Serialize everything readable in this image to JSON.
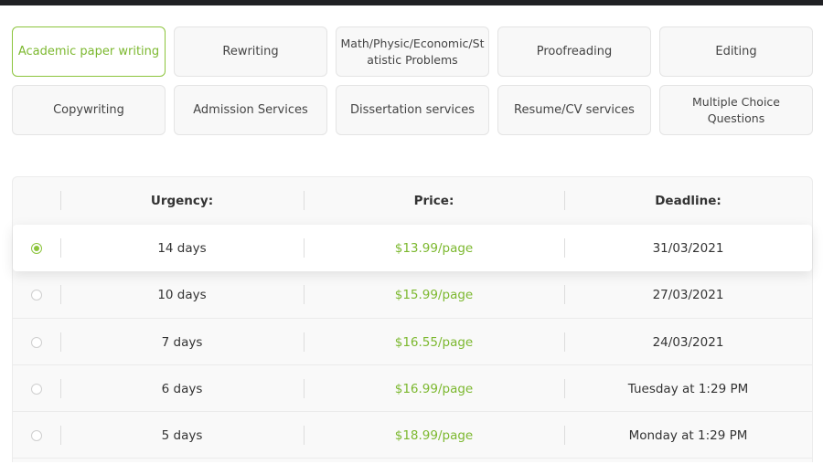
{
  "services": [
    {
      "label": "Academic paper writing",
      "active": true
    },
    {
      "label": "Rewriting",
      "active": false
    },
    {
      "label": "Math/Physic/Economic/Statistic Problems",
      "active": false
    },
    {
      "label": "Proofreading",
      "active": false
    },
    {
      "label": "Editing",
      "active": false
    },
    {
      "label": "Copywriting",
      "active": false
    },
    {
      "label": "Admission Services",
      "active": false
    },
    {
      "label": "Dissertation services",
      "active": false
    },
    {
      "label": "Resume/CV services",
      "active": false
    },
    {
      "label": "Multiple Choice Questions",
      "active": false
    }
  ],
  "table": {
    "headers": {
      "urgency": "Urgency:",
      "price": "Price:",
      "deadline": "Deadline:"
    },
    "rows": [
      {
        "urgency": "14 days",
        "price": "$13.99/page",
        "deadline": "31/03/2021",
        "selected": true
      },
      {
        "urgency": "10 days",
        "price": "$15.99/page",
        "deadline": "27/03/2021",
        "selected": false
      },
      {
        "urgency": "7 days",
        "price": "$16.55/page",
        "deadline": "24/03/2021",
        "selected": false
      },
      {
        "urgency": "6 days",
        "price": "$16.99/page",
        "deadline": "Tuesday at 1:29 PM",
        "selected": false
      },
      {
        "urgency": "5 days",
        "price": "$18.99/page",
        "deadline": "Monday at 1:29 PM",
        "selected": false
      }
    ]
  },
  "colors": {
    "accent": "#8cc43c",
    "price": "#7cb82f"
  }
}
